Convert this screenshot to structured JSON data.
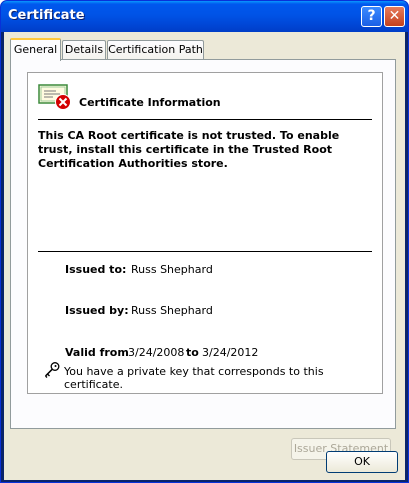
{
  "window": {
    "title": "Certificate",
    "help_glyph": "?",
    "close_glyph": "✕"
  },
  "tabs": [
    {
      "label": "General",
      "active": true
    },
    {
      "label": "Details",
      "active": false
    },
    {
      "label": "Certification Path",
      "active": false
    }
  ],
  "info": {
    "heading": "Certificate Information",
    "message": "This CA Root certificate is not trusted. To enable trust, install this certificate in the Trusted Root Certification Authorities store."
  },
  "fields": {
    "issued_to_label": "Issued to:",
    "issued_to_value": "Russ Shephard",
    "issued_by_label": "Issued by:",
    "issued_by_value": "Russ Shephard",
    "valid_from_label": "Valid from",
    "valid_from_value": "3/24/2008",
    "valid_to_label": "to",
    "valid_to_value": "3/24/2012"
  },
  "private_key_note": "You have a private key that corresponds to this certificate.",
  "buttons": {
    "issuer_statement": "Issuer Statement",
    "ok": "OK"
  },
  "icons": {
    "certificate": "certificate-untrusted-icon",
    "key": "key-icon"
  },
  "colors": {
    "titlebar": "#0058ee",
    "dialog_bg": "#ece9d8",
    "active_tab_accent": "#ffc83c",
    "error_red": "#d40000"
  }
}
